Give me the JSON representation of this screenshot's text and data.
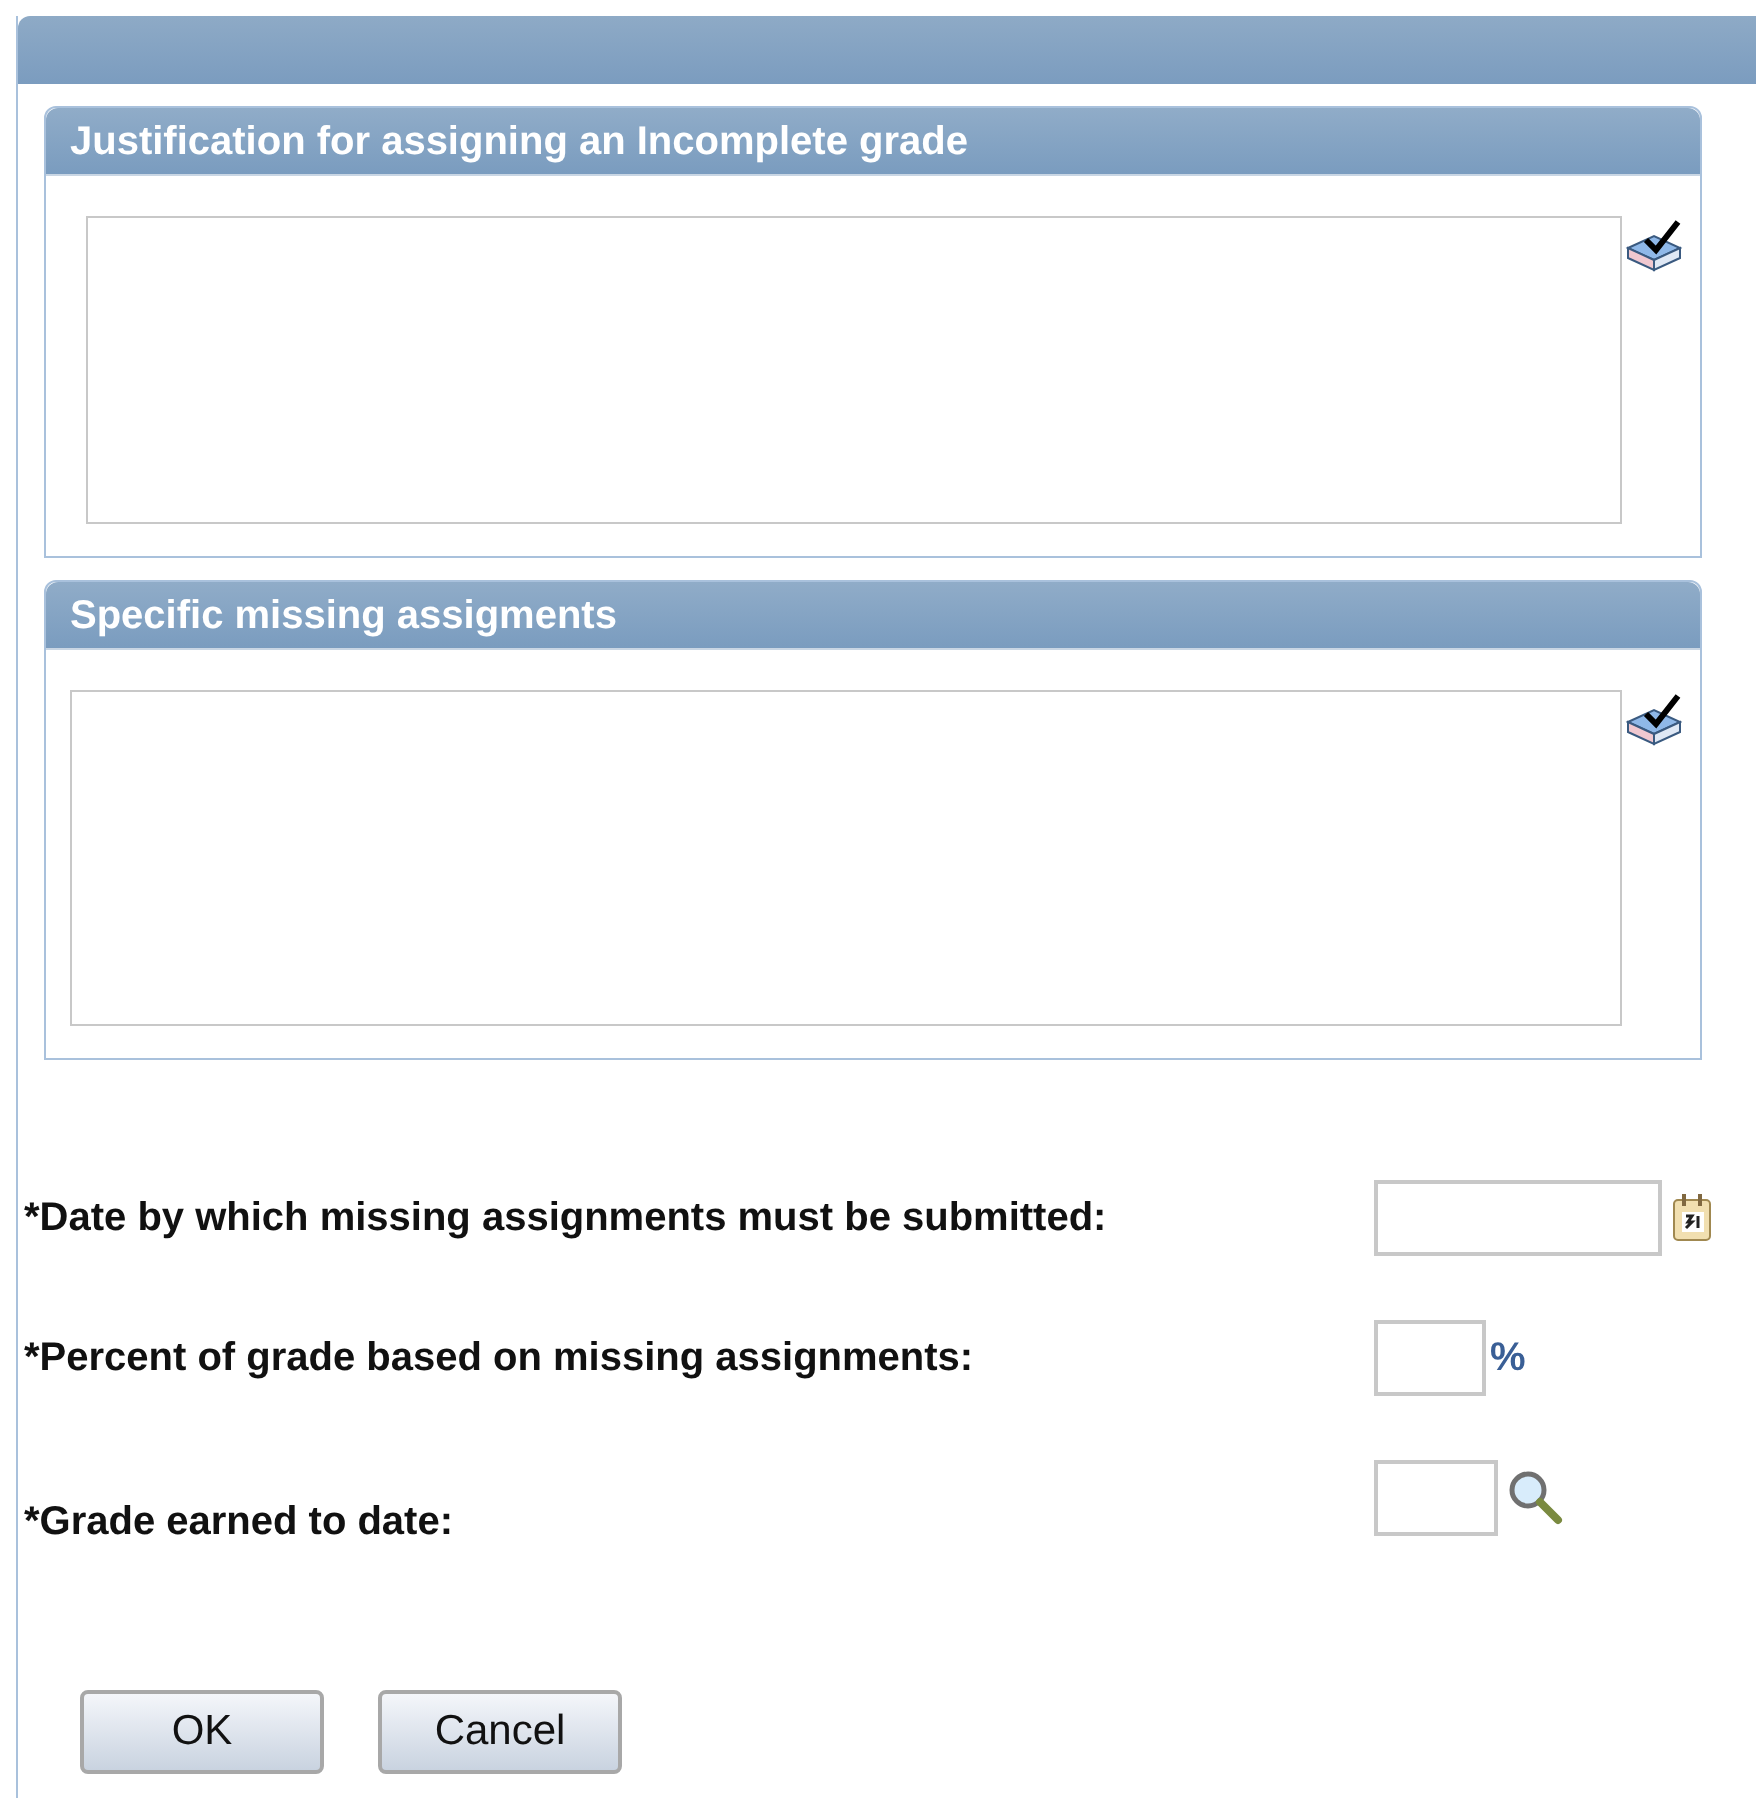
{
  "sections": [
    {
      "title": "Justification for assigning an Incomplete grade"
    },
    {
      "title": "Specific missing assigments"
    }
  ],
  "fields": [
    {
      "kind": "date",
      "label": "*Date by which missing assignments must be submitted:"
    },
    {
      "kind": "percent",
      "label": "*Percent of grade based on missing assignments:",
      "suffix": "%"
    },
    {
      "kind": "lookup",
      "label": "*Grade earned to date:"
    }
  ],
  "buttons": [
    "OK",
    "Cancel"
  ]
}
